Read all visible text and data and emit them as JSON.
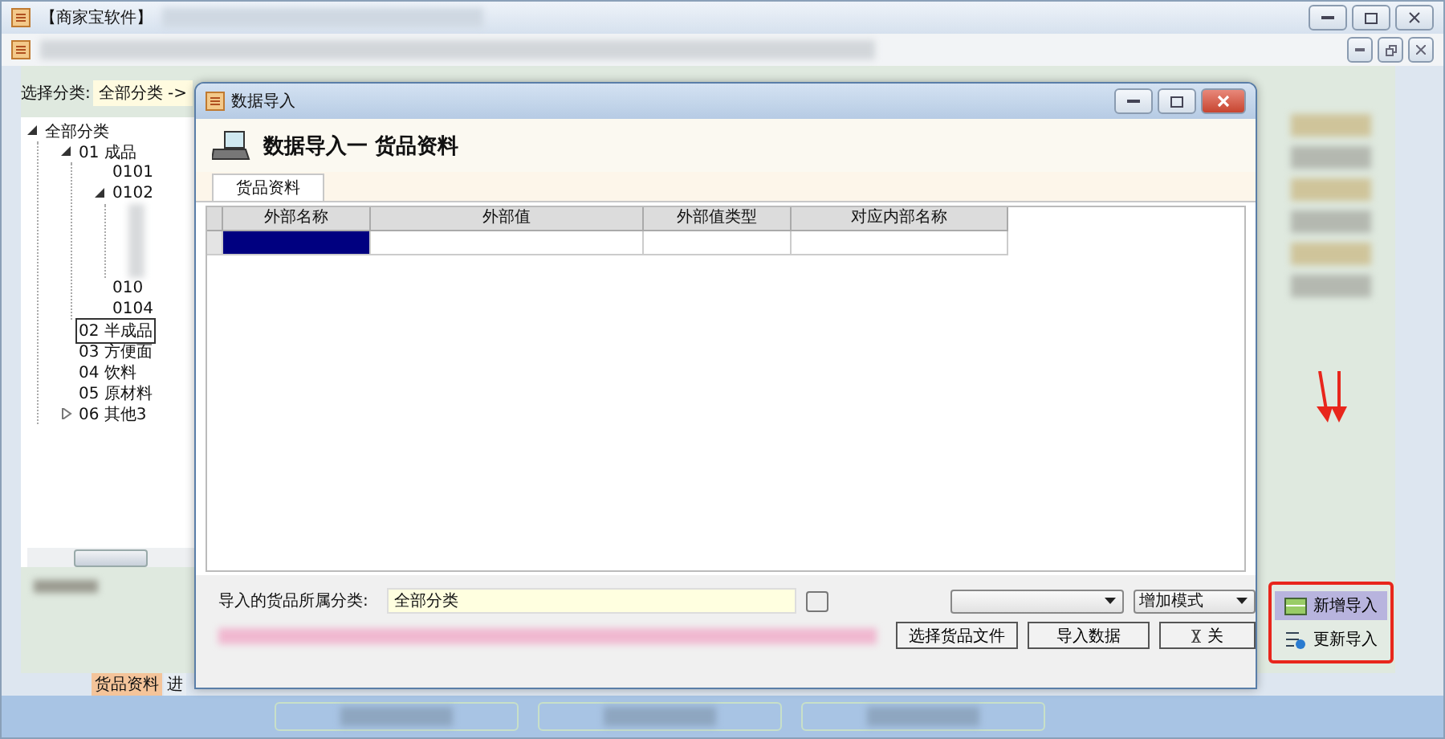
{
  "window": {
    "title": "【商家宝软件】"
  },
  "filter": {
    "label": "选择分类:",
    "value": "全部分类 ->"
  },
  "tree": [
    {
      "label": "全部分类",
      "expanded": true,
      "selected": false,
      "children": [
        {
          "label": "01 成品",
          "expanded": true,
          "selected": false,
          "children": [
            {
              "label": "0101",
              "selected": false
            },
            {
              "label": "0102",
              "expanded": true,
              "selected": false
            },
            {
              "label": "010",
              "selected": false
            },
            {
              "label": "0104",
              "selected": false
            }
          ]
        },
        {
          "label": "02 半成品",
          "selected": true
        },
        {
          "label": "03 方便面",
          "selected": false
        },
        {
          "label": "04 饮料",
          "selected": false
        },
        {
          "label": "05 原材料",
          "selected": false
        },
        {
          "label": "06 其他3",
          "expanded": false,
          "selected": false
        }
      ]
    }
  ],
  "dialog": {
    "title": "数据导入",
    "heading": "数据导入一  货品资料",
    "tabs": [
      {
        "label": "货品资料",
        "selected": true
      }
    ],
    "table": {
      "columns": [
        "外部名称",
        "外部值",
        "外部值类型",
        "对应内部名称"
      ],
      "rows": [
        {
          "selected": true
        }
      ]
    },
    "category": {
      "label": "导入的货品所属分类:",
      "value": "全部分类"
    },
    "mode": {
      "value": "增加模式"
    },
    "buttons": [
      "选择货品文件",
      "导入数据",
      "关"
    ]
  },
  "sidebar": {
    "actions": [
      {
        "label": "新增导入",
        "selected": true,
        "kind": "new"
      },
      {
        "label": "更新导入",
        "selected": false,
        "kind": "update"
      }
    ]
  },
  "bottom_tabs": [
    {
      "label": "货品资料",
      "selected": true
    },
    {
      "label": "进",
      "selected": false
    }
  ]
}
